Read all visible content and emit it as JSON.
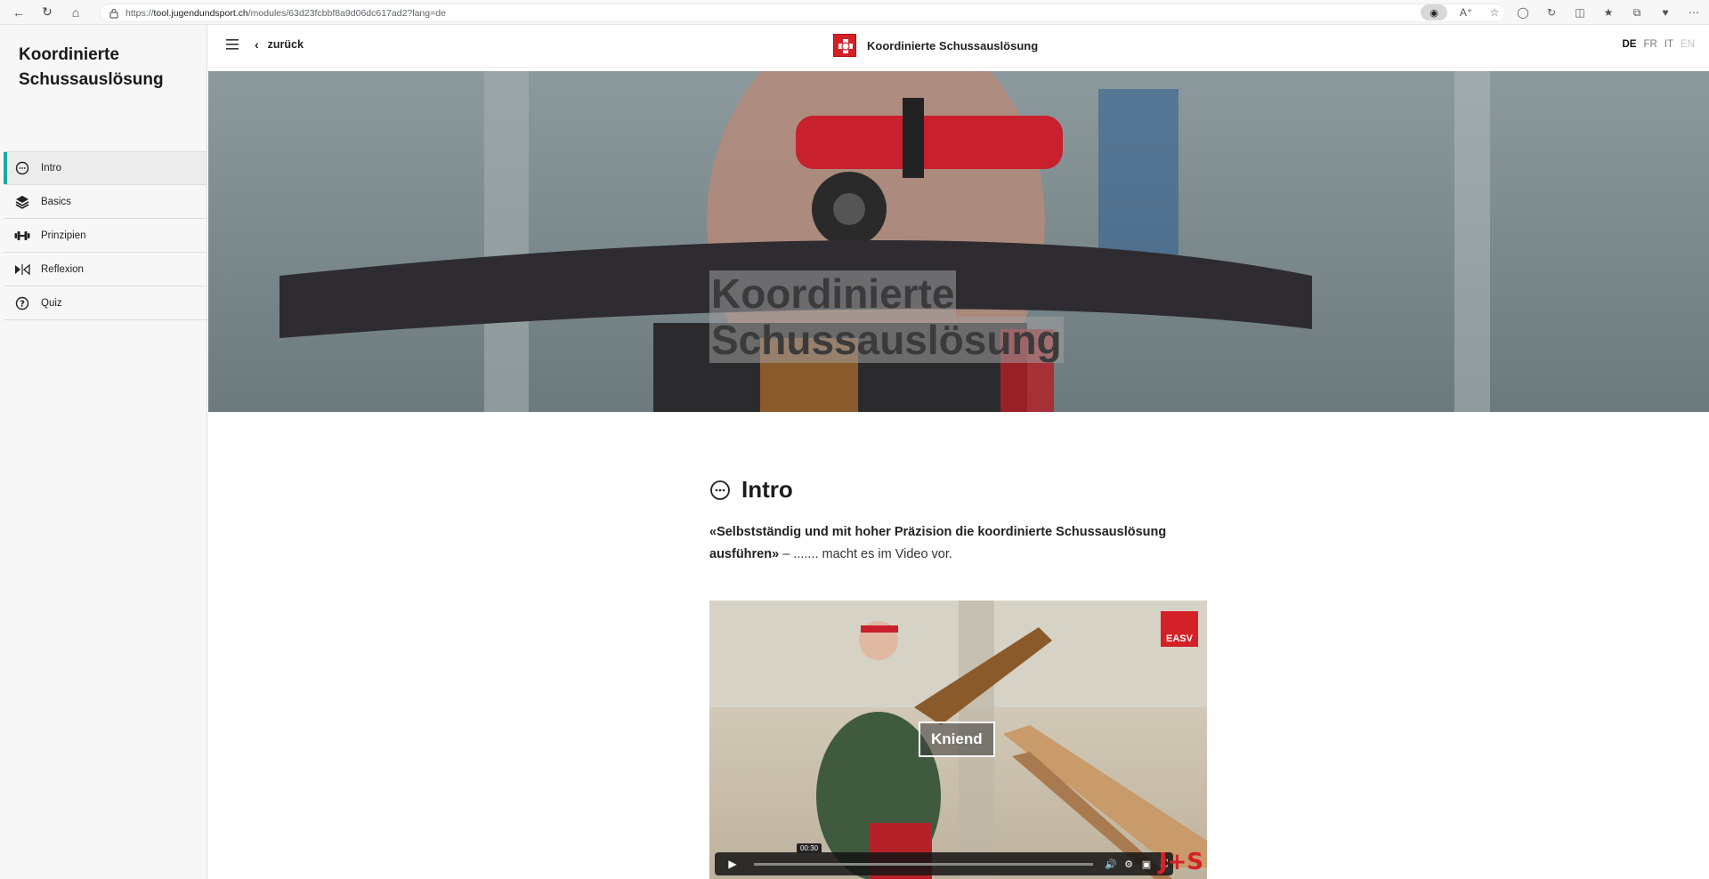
{
  "browser": {
    "url_prefix": "https://",
    "url_host": "tool.jugendundsport.ch",
    "url_path": "/modules/63d23fcbbf8a9d06dc617ad2?lang=de"
  },
  "sidebar": {
    "title": "Koordinierte Schussauslösung",
    "items": [
      {
        "label": "Intro",
        "icon": "chat-bubble-icon",
        "active": true
      },
      {
        "label": "Basics",
        "icon": "layers-icon",
        "active": false
      },
      {
        "label": "Prinzipien",
        "icon": "dumbbell-icon",
        "active": false
      },
      {
        "label": "Reflexion",
        "icon": "reflect-icon",
        "active": false
      },
      {
        "label": "Quiz",
        "icon": "question-icon",
        "active": false
      }
    ]
  },
  "header": {
    "back_label": "zurück",
    "title": "Koordinierte Schussauslösung",
    "languages": [
      {
        "code": "DE",
        "state": "active"
      },
      {
        "code": "FR",
        "state": "normal"
      },
      {
        "code": "IT",
        "state": "normal"
      },
      {
        "code": "EN",
        "state": "disabled"
      }
    ]
  },
  "hero": {
    "title_line1": "Koordinierte",
    "title_line2": "Schussauslösung"
  },
  "section": {
    "title": "Intro",
    "quote": "«Selbstständig und mit hoher Präzision die koordinierte Schussauslösung ausführen»",
    "rest": " – ....... macht es im Video vor."
  },
  "video": {
    "label": "Kniend",
    "time": "00:30",
    "brand": "EASV"
  },
  "colors": {
    "accent": "#1fa89a",
    "brand_red": "#d42027"
  }
}
